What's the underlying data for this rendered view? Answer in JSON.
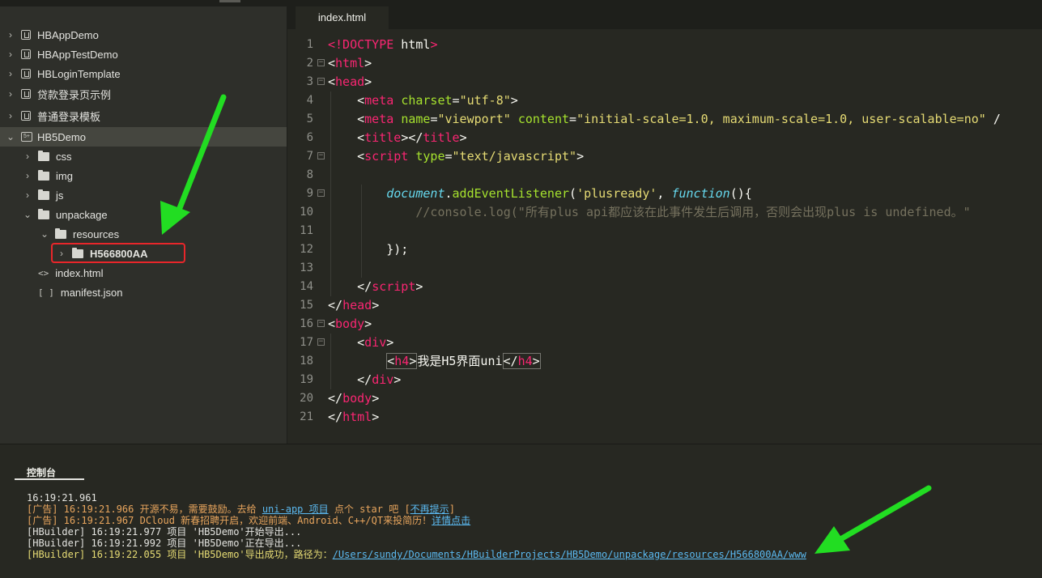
{
  "sidebar": {
    "projects": [
      {
        "label": "HBAppDemo"
      },
      {
        "label": "HBAppTestDemo"
      },
      {
        "label": "HBLoginTemplate"
      },
      {
        "label": "贷款登录页示例"
      },
      {
        "label": "普通登录模板"
      },
      {
        "label": "HB5Demo",
        "icon_text": "5+"
      }
    ],
    "tree": {
      "css": "css",
      "img": "img",
      "js": "js",
      "unpackage": "unpackage",
      "resources": "resources",
      "h5_folder": "H566800AA",
      "index": "index.html",
      "manifest": "manifest.json"
    }
  },
  "editor": {
    "tab_label": "index.html",
    "line_numbers": [
      "1",
      "2",
      "3",
      "4",
      "5",
      "6",
      "7",
      "8",
      "9",
      "10",
      "11",
      "12",
      "13",
      "14",
      "15",
      "16",
      "17",
      "18",
      "19",
      "20",
      "21"
    ]
  },
  "console": {
    "tab_label": "控制台",
    "lines": {
      "l1": "16:19:21.961",
      "l2_prefix": "[广告] 16:19:21.966 开源不易，需要鼓励。去给 ",
      "l2_link1": "uni-app 项目",
      "l2_mid": " 点个 star 吧 [",
      "l2_link2": "不再提示",
      "l2_suffix": "]",
      "l3_prefix": "[广告] 16:19:21.967 DCloud 新春招聘开启，欢迎前端、Android、C++/QT来投简历！",
      "l3_link": "详情点击",
      "l4": "[HBuilder] 16:19:21.977 项目 'HB5Demo'开始导出...",
      "l5": "[HBuilder] 16:19:21.992 项目 'HB5Demo'正在导出...",
      "l6_prefix": "[HBuilder] 16:19:22.055 项目 'HB5Demo'导出成功，路径为：",
      "l6_link": "/Users/sundy/Documents/HBuilderProjects/HB5Demo/unpackage/resources/H566800AA/www"
    }
  },
  "colors": {
    "arrow": "#22dd22",
    "highlight_box": "#e8262a",
    "link": "#5bb9f0",
    "tag": "#f92672",
    "attribute": "#a6e22e",
    "string": "#e6db74"
  }
}
